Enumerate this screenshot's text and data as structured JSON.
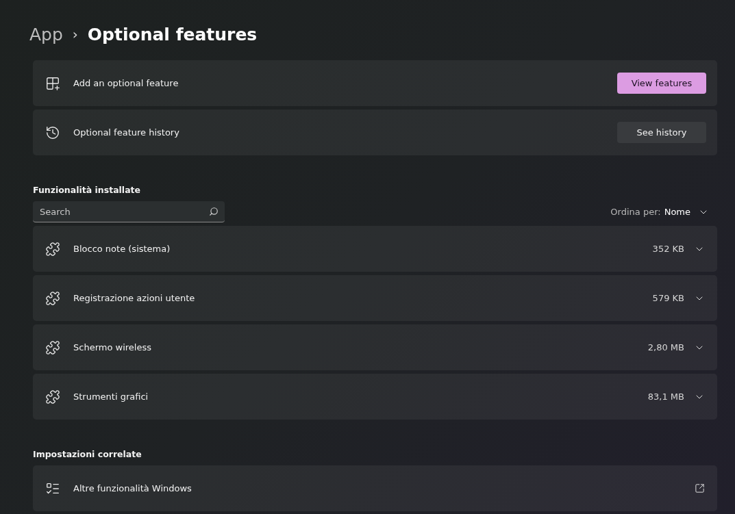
{
  "breadcrumb": {
    "parent": "App",
    "separator": "›",
    "current": "Optional features"
  },
  "actions": [
    {
      "label": "Add an optional feature",
      "button": {
        "label": "View features",
        "kind": "primary"
      }
    },
    {
      "label": "Optional feature history",
      "button": {
        "label": "See history",
        "kind": "secondary"
      }
    }
  ],
  "installed": {
    "heading": "Funzionalità installate",
    "search": {
      "placeholder": "Search"
    },
    "sort": {
      "label": "Ordina per:",
      "value": "Nome"
    },
    "features": [
      {
        "name": "Blocco note (sistema)",
        "size": "352 KB",
        "expanded": false
      },
      {
        "name": "Registrazione azioni utente",
        "size": "579 KB",
        "expanded": false
      },
      {
        "name": "Schermo wireless",
        "size": "2,80 MB",
        "expanded": false
      },
      {
        "name": "Strumenti grafici",
        "size": "83,1 MB",
        "expanded": false
      }
    ]
  },
  "related": {
    "heading": "Impostazioni correlate",
    "items": [
      {
        "label": "Altre funzionalità Windows"
      }
    ]
  }
}
